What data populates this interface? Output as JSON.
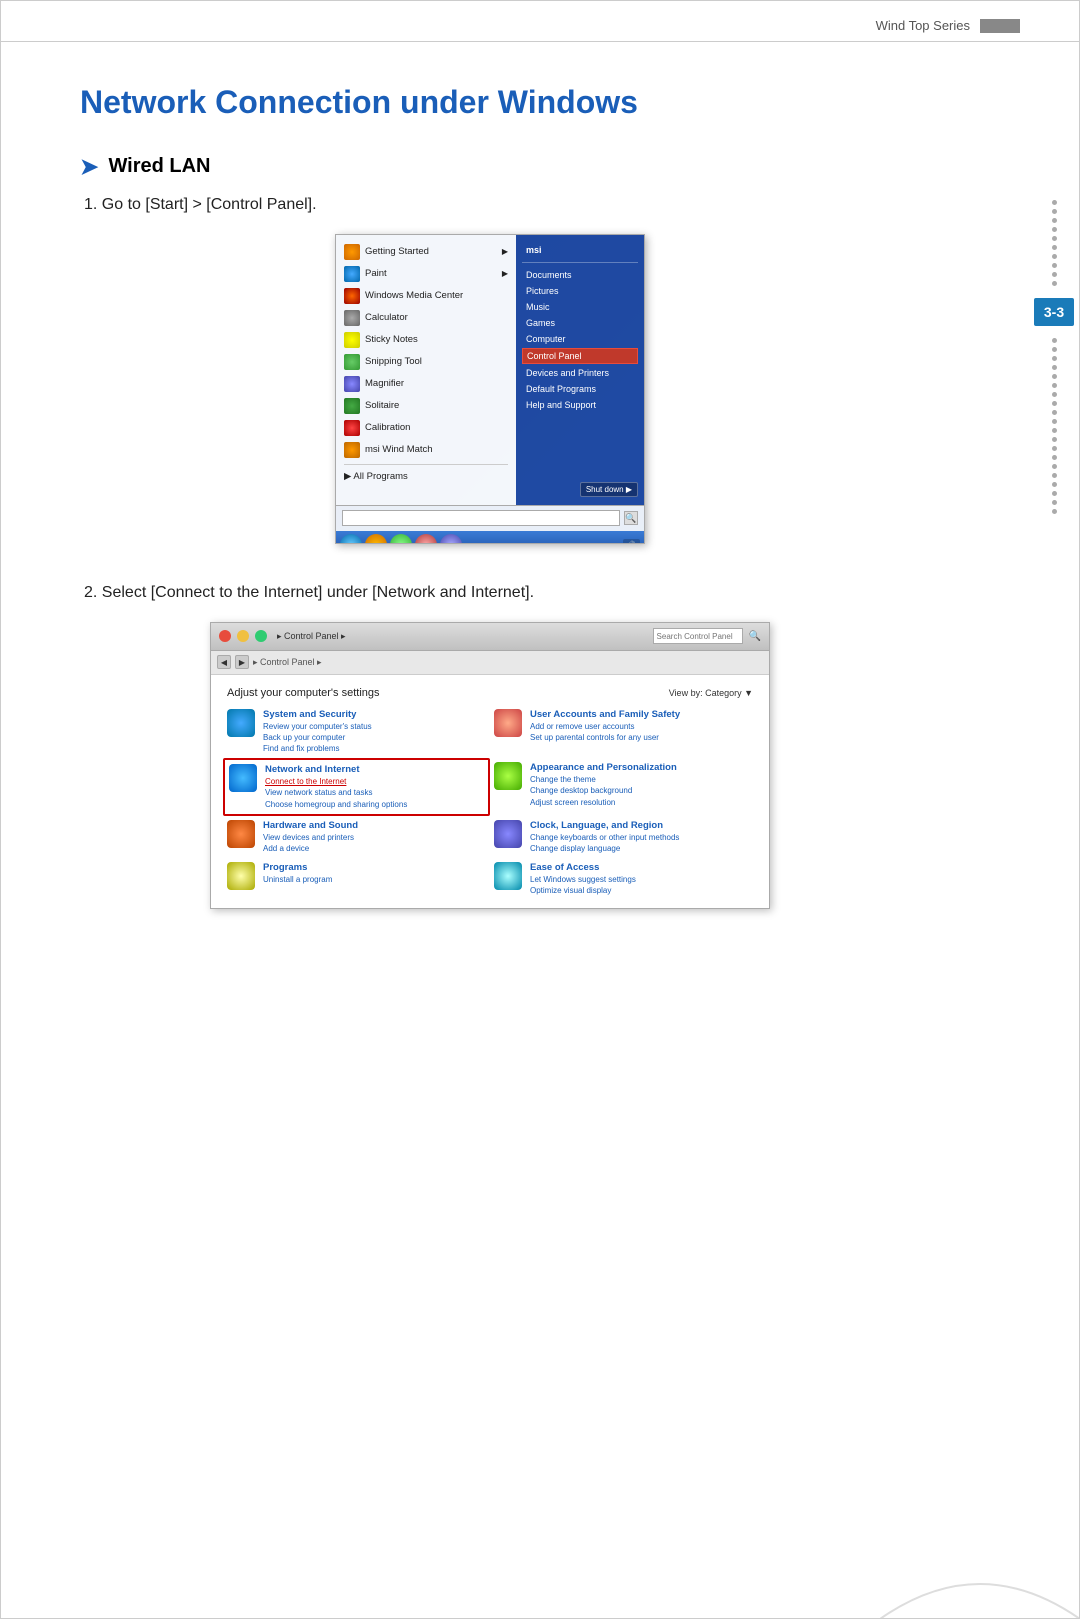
{
  "header": {
    "series_label": "Wind Top Series"
  },
  "page_number": "3-3",
  "page_title": "Network Connection under Windows",
  "section": {
    "heading": "Wired LAN",
    "arrow": "➤"
  },
  "steps": {
    "step1_label": "1.  Go to [Start] > [Control Panel].",
    "step2_label": "2.  Select [Connect to the Internet] under [Network and Internet]."
  },
  "start_menu": {
    "items": [
      {
        "label": "Getting Started"
      },
      {
        "label": "Paint"
      },
      {
        "label": "Windows Media Center"
      },
      {
        "label": "Calculator"
      },
      {
        "label": "Sticky Notes"
      },
      {
        "label": "Snipping Tool"
      },
      {
        "label": "Magnifier"
      },
      {
        "label": "Solitaire"
      },
      {
        "label": "Calibration"
      },
      {
        "label": "msi Wind Match"
      }
    ],
    "all_programs": "▶  All Programs",
    "search_placeholder": "",
    "right_items": [
      {
        "label": "msi",
        "bold": true
      },
      {
        "label": "Documents"
      },
      {
        "label": "Pictures"
      },
      {
        "label": "Music"
      },
      {
        "label": "Games"
      },
      {
        "label": "Computer"
      },
      {
        "label": "Control Panel",
        "highlighted": true
      },
      {
        "label": "Devices and Printers"
      },
      {
        "label": "Default Programs"
      },
      {
        "label": "Help and Support"
      }
    ],
    "shutdown_label": "Shut down  ▶"
  },
  "control_panel": {
    "titlebar": "▸ Control Panel ▸",
    "search_placeholder": "Search Control Panel",
    "adjust_text": "Adjust your computer's settings",
    "view_by": "View by:  Category ▼",
    "categories": [
      {
        "title": "System and Security",
        "links": [
          "Review your computer's status",
          "Back up your computer",
          "Find and fix problems"
        ],
        "icon_class": "cp-cat-icon-sys"
      },
      {
        "title": "User Accounts and Family Safety",
        "links": [
          "Add or remove user accounts",
          "Set up parental controls for any user"
        ],
        "icon_class": "cp-cat-icon-user"
      },
      {
        "title": "Network and Internet",
        "links": [
          "Connect to the Internet",
          "View network status and tasks",
          "Choose homegroup and sharing options"
        ],
        "icon_class": "cp-cat-icon-net",
        "highlighted": true
      },
      {
        "title": "Appearance and Personalization",
        "links": [
          "Change the theme",
          "Change desktop background",
          "Adjust screen resolution"
        ],
        "icon_class": "cp-cat-icon-appear"
      },
      {
        "title": "Hardware and Sound",
        "links": [
          "View devices and printers",
          "Add a device"
        ],
        "icon_class": "cp-cat-icon-hw"
      },
      {
        "title": "Clock, Language, and Region",
        "links": [
          "Change keyboards or other input methods",
          "Change display language"
        ],
        "icon_class": "cp-cat-icon-clock"
      },
      {
        "title": "Programs",
        "links": [
          "Uninstall a program"
        ],
        "icon_class": "cp-cat-icon-prog"
      },
      {
        "title": "Ease of Access",
        "links": [
          "Let Windows suggest settings",
          "Optimize visual display"
        ],
        "icon_class": "cp-cat-icon-ease"
      }
    ]
  },
  "colors": {
    "title_blue": "#1a5eb8",
    "accent_blue": "#1a7bb9",
    "highlight_red": "#c00000"
  }
}
